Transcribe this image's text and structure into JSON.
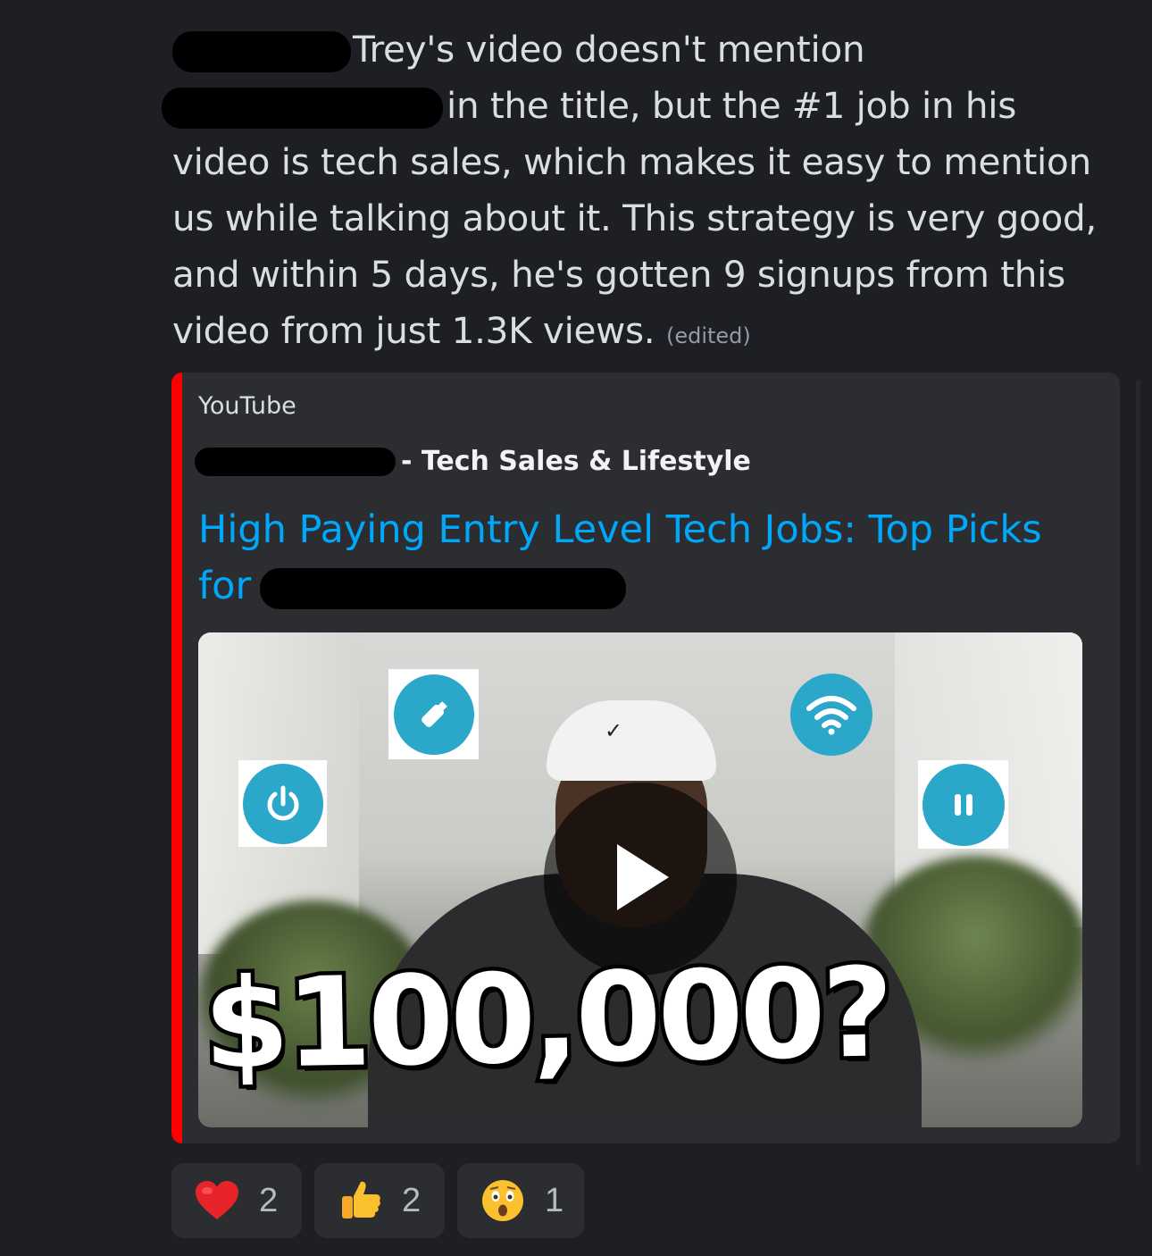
{
  "message": {
    "line1": "Trey's video doesn't mention",
    "line2": "in the title, but the #1 job in his",
    "line3": "video is tech sales, which makes it easy to mention",
    "line4": "us while talking about it. This strategy is very good,",
    "line5": "and within 5 days, he's gotten 9 signups from this",
    "line6": "video from just 1.3K views.",
    "edited_label": "(edited)"
  },
  "embed": {
    "provider": "YouTube",
    "author_suffix": "- Tech Sales & Lifestyle",
    "title_line1": "High Paying Entry Level Tech Jobs: Top Picks",
    "title_line2": "for",
    "accent_color": "#ff0000",
    "link_color": "#00a8fc",
    "thumbnail": {
      "overlay_text": "$100,000?",
      "icons": [
        "usb-drive-icon",
        "wifi-icon",
        "power-icon",
        "pause-icon"
      ],
      "play_button": "play-icon"
    }
  },
  "reactions": [
    {
      "emoji": "heart-icon",
      "count": "2"
    },
    {
      "emoji": "thumbs-up-icon",
      "count": "2"
    },
    {
      "emoji": "astonished-face-icon",
      "count": "1"
    }
  ]
}
